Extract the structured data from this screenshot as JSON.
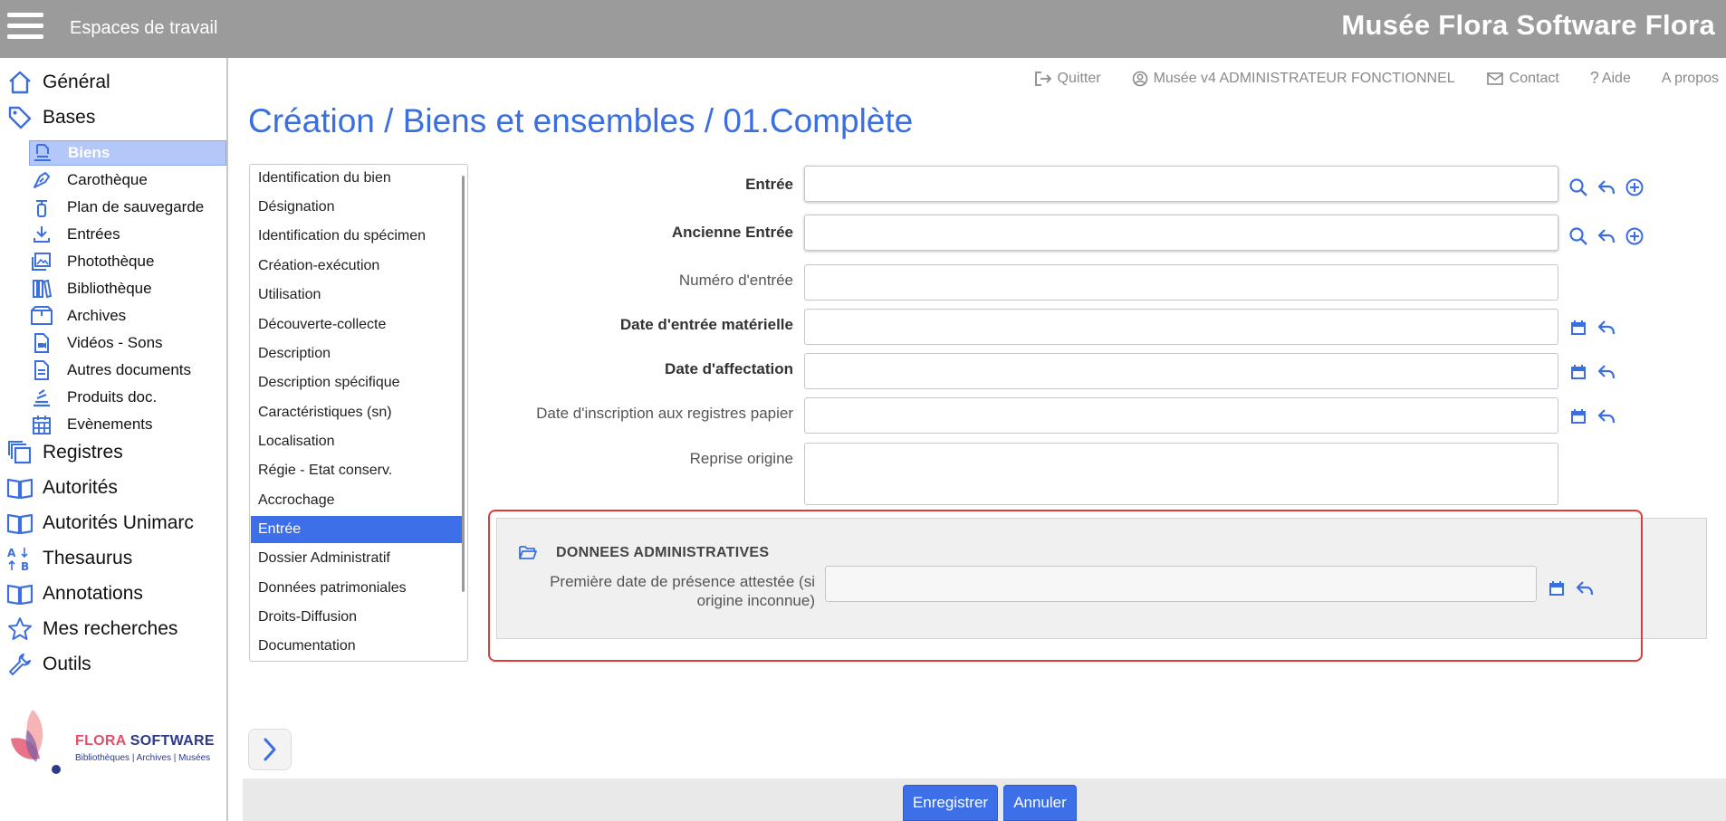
{
  "header": {
    "workspaces_label": "Espaces de travail",
    "app_title": "Musée Flora Software Flora"
  },
  "top_links": {
    "quit": "Quitter",
    "user": "Musée v4 ADMINISTRATEUR FONCTIONNEL",
    "contact": "Contact",
    "help": "Aide",
    "about": "A propos"
  },
  "sidebar": {
    "general": "Général",
    "bases": "Bases",
    "sub_items": [
      {
        "label": "Biens",
        "icon": "object-icon"
      },
      {
        "label": "Carothèque",
        "icon": "pen-nib-icon"
      },
      {
        "label": "Plan de sauvegarde",
        "icon": "fire-extinguisher-icon"
      },
      {
        "label": "Entrées",
        "icon": "download-icon"
      },
      {
        "label": "Photothèque",
        "icon": "images-icon"
      },
      {
        "label": "Bibliothèque",
        "icon": "books-icon"
      },
      {
        "label": "Archives",
        "icon": "archive-box-icon"
      },
      {
        "label": "Vidéos - Sons",
        "icon": "video-file-icon"
      },
      {
        "label": "Autres documents",
        "icon": "document-icon"
      },
      {
        "label": "Produits doc.",
        "icon": "stack-icon"
      },
      {
        "label": "Evènements",
        "icon": "calendar-icon"
      }
    ],
    "registres": "Registres",
    "autorites": "Autorités",
    "autorites_unimarc": "Autorités Unimarc",
    "thesaurus": "Thesaurus",
    "annotations": "Annotations",
    "mes_recherches": "Mes recherches",
    "outils": "Outils",
    "logo_brand_a": "FLORA",
    "logo_brand_b": " SOFTWARE",
    "logo_tagline": "Bibliothèques | Archives | Musées"
  },
  "page_title": "Création / Biens et ensembles / 01.Complète",
  "sections": [
    "Identification du bien",
    "Désignation",
    "Identification du spécimen",
    "Création-exécution",
    "Utilisation",
    "Découverte-collecte",
    "Description",
    "Description spécifique",
    "Caractéristiques (sn)",
    "Localisation",
    "Régie - Etat conserv.",
    "Accrochage",
    "Entrée",
    "Dossier Administratif",
    "Données patrimoniales",
    "Droits-Diffusion",
    "Documentation"
  ],
  "active_section": "Entrée",
  "fields": {
    "entree": {
      "label": "Entrée",
      "value": ""
    },
    "ancienne_entree": {
      "label": "Ancienne Entrée",
      "value": ""
    },
    "numero_entree": {
      "label": "Numéro d'entrée",
      "value": ""
    },
    "date_entree_materielle": {
      "label": "Date d'entrée matérielle",
      "value": ""
    },
    "date_affectation": {
      "label": "Date d'affectation",
      "value": ""
    },
    "date_inscription": {
      "label": "Date d'inscription aux registres papier",
      "value": ""
    },
    "reprise_origine": {
      "label": "Reprise origine",
      "value": ""
    }
  },
  "admin_group": {
    "title": "DONNEES ADMINISTRATIVES",
    "field_label_line1": "Première date de présence attestée (si",
    "field_label_line2": "origine inconnue)",
    "value": ""
  },
  "buttons": {
    "save": "Enregistrer",
    "cancel": "Annuler"
  },
  "colors": {
    "accent": "#3d6fe8",
    "header_bg": "#9b9b9b",
    "highlight": "#e23a3a"
  }
}
